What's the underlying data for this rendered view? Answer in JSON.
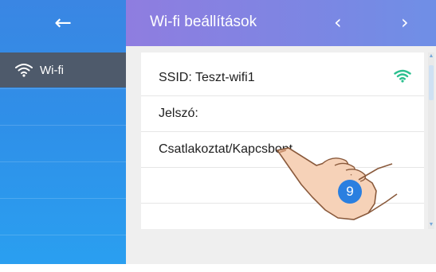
{
  "header": {
    "back_icon": "←",
    "title": "Wi-fi beállítások",
    "prev_icon": "‹",
    "next_icon": "›"
  },
  "sidebar": {
    "items": [
      {
        "label": "Wi-fi",
        "icon": "wifi-icon",
        "selected": true
      }
    ]
  },
  "main": {
    "rows": [
      {
        "label": "SSID: Teszt-wifi1",
        "icon": "wifi-signal-icon",
        "icon_color": "#2bbf8f"
      },
      {
        "label": "Jelszó:"
      },
      {
        "label": "Csatlakoztat/Kapcsbont"
      },
      {
        "label": ""
      },
      {
        "label": ""
      }
    ]
  },
  "overlay": {
    "step_number": "9",
    "hand_icon": "pointing-hand-icon"
  },
  "colors": {
    "header_gradient_start": "#8f7de0",
    "header_gradient_end": "#6f8fe6",
    "sidebar_blue": "#2f8fe8",
    "sidebar_selected": "#4e5a6b",
    "content_background": "#efefef",
    "wifi_signal": "#2bbf8f",
    "step_badge": "#2a7fe0"
  }
}
